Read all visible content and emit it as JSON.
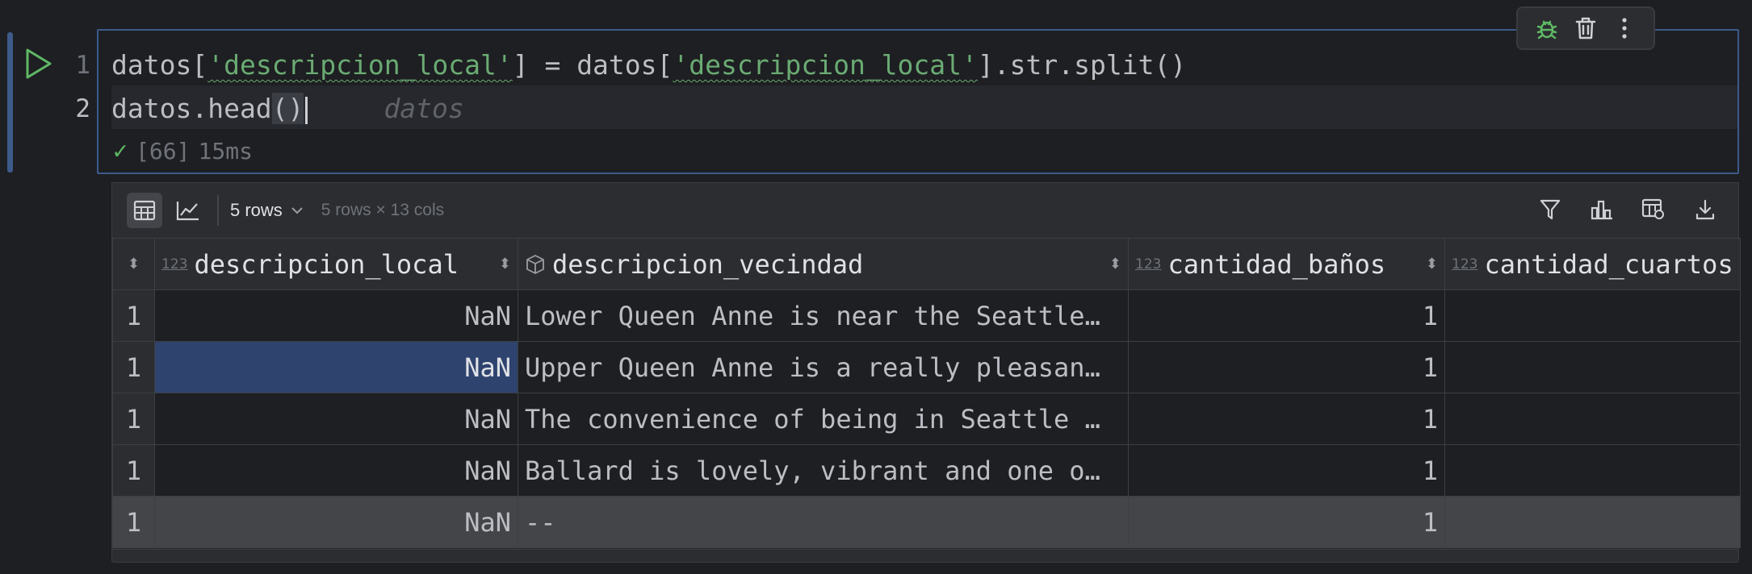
{
  "cell": {
    "line_numbers": [
      "1",
      "2"
    ],
    "code": {
      "line1_a": "datos[",
      "line1_str1": "'descripcion_local'",
      "line1_b": "] = datos[",
      "line1_str2": "'descripcion_local'",
      "line1_c": "].str.split()",
      "line2_a": "datos.head",
      "line2_paren": "()",
      "line2_hint": "datos"
    },
    "status": {
      "count": "[66]",
      "time": "15ms"
    },
    "toolbar_icons": [
      "bug-icon",
      "trash-icon",
      "more-vertical-icon"
    ]
  },
  "output": {
    "rows_label": "5 rows",
    "dims": "5 rows × 13 cols",
    "type_icon_label": "123",
    "columns": [
      {
        "name": "descripcion_local",
        "type": "numeric"
      },
      {
        "name": "descripcion_vecindad",
        "type": "object"
      },
      {
        "name": "cantidad_baños",
        "type": "numeric"
      },
      {
        "name": "cantidad_cuartos",
        "type": "numeric"
      }
    ],
    "rows": [
      {
        "idx": "1",
        "c1": "NaN",
        "c2": "Lower Queen Anne is near the Seattle…",
        "c3": "1",
        "c4": ""
      },
      {
        "idx": "1",
        "c1": "NaN",
        "c2": "Upper Queen Anne is a really pleasan…",
        "c3": "1",
        "c4": ""
      },
      {
        "idx": "1",
        "c1": "NaN",
        "c2": "The convenience of being in Seattle …",
        "c3": "1",
        "c4": ""
      },
      {
        "idx": "1",
        "c1": "NaN",
        "c2": "Ballard is lovely, vibrant and one o…",
        "c3": "1",
        "c4": ""
      },
      {
        "idx": "1",
        "c1": "NaN",
        "c2": "--",
        "c3": "1",
        "c4": ""
      }
    ]
  },
  "colors": {
    "accent": "#3d5a8c",
    "selection": "#2e436e",
    "string": "#6aab73",
    "success": "#5fb865"
  }
}
